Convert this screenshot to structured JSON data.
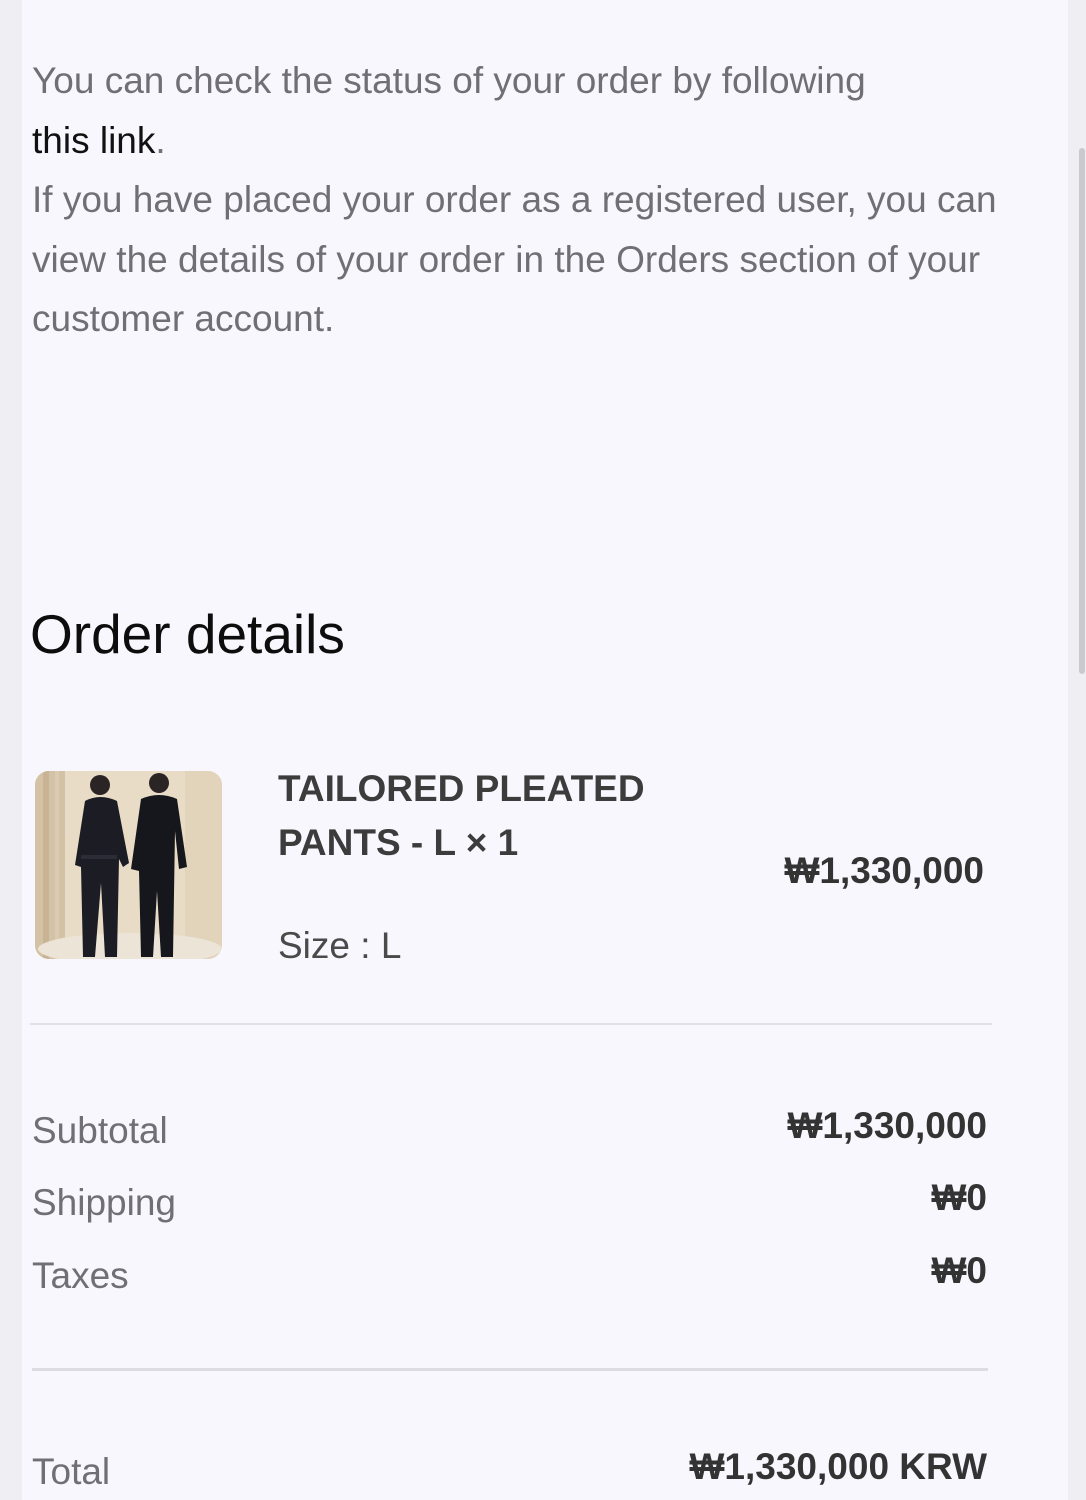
{
  "intro": {
    "line1": "You can check the status of your order by following",
    "link_text": "this link",
    "link_suffix": ".",
    "line2": "If you have placed your order as a registered user, you can view the details of your order in the Orders section of your customer account."
  },
  "order_details": {
    "title": "Order details",
    "item": {
      "name": "TAILORED PLEATED PANTS - L × 1",
      "size": "Size : L",
      "price": "₩1,330,000",
      "image_alt": "Two models in dark outfits"
    },
    "summary": {
      "subtotal_label": "Subtotal",
      "subtotal_value": "₩1,330,000",
      "shipping_label": "Shipping",
      "shipping_value": "₩0",
      "taxes_label": "Taxes",
      "taxes_value": "₩0",
      "total_label": "Total",
      "total_value": "₩1,330,000 KRW"
    }
  },
  "colors": {
    "background": "#f7f7fd",
    "body_text": "#6f6f75",
    "heading_text": "#0d0d0d",
    "link_text": "#111111"
  }
}
